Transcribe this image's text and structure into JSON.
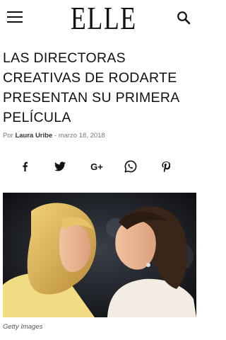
{
  "header": {
    "logo": "ELLE",
    "menu_icon": "hamburger-menu-icon",
    "search_icon": "search-icon"
  },
  "article": {
    "title": "LAS DIRECTORAS CREATIVAS DE RODARTE PRESENTAN SU PRIMERA PELÍCULA",
    "byline_prefix": "Por",
    "author": "Laura Uribe",
    "separator": "-",
    "date": "marzo 18, 2018",
    "caption": "Getty Images"
  },
  "share": [
    {
      "name": "facebook",
      "icon": "facebook-icon",
      "glyph": "f"
    },
    {
      "name": "twitter",
      "icon": "twitter-icon",
      "glyph": ""
    },
    {
      "name": "google-plus",
      "icon": "google-plus-icon",
      "glyph": "G+"
    },
    {
      "name": "whatsapp",
      "icon": "whatsapp-icon",
      "glyph": ""
    },
    {
      "name": "pinterest",
      "icon": "pinterest-icon",
      "glyph": "p"
    }
  ]
}
